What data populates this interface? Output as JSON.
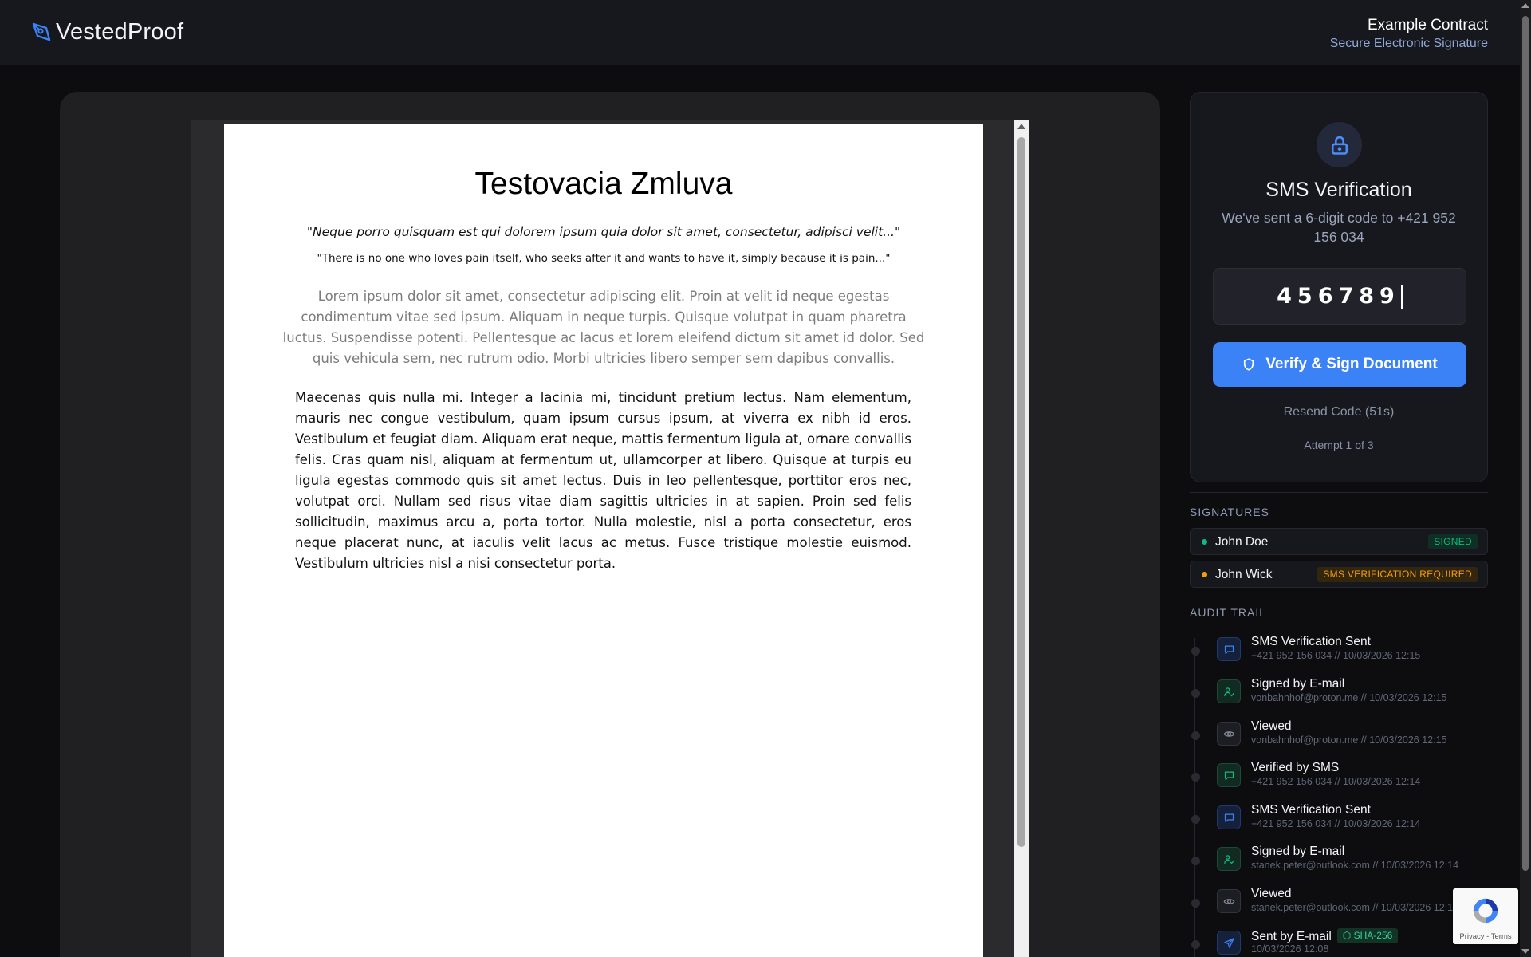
{
  "header": {
    "brand": "VestedProof",
    "doc_title": "Example Contract",
    "doc_subtitle": "Secure Electronic Signature"
  },
  "document": {
    "title": "Testovacia Zmluva",
    "quote_italic": "\"Neque porro quisquam est qui dolorem ipsum quia dolor sit amet, consectetur, adipisci velit...\"",
    "quote_plain": "\"There is no one who loves pain itself, who seeks after it and wants to have it, simply because it is pain...\"",
    "paragraph_gray": "Lorem ipsum dolor sit amet, consectetur adipiscing elit. Proin at velit id neque egestas condimentum vitae sed ipsum. Aliquam in neque turpis. Quisque volutpat in quam pharetra luctus. Suspendisse potenti. Pellentesque ac lacus et lorem eleifend dictum sit amet id dolor. Sed quis vehicula sem, nec rutrum odio. Morbi ultricies libero semper sem dapibus convallis.",
    "paragraph_body": "Maecenas quis nulla mi. Integer a lacinia mi, tincidunt pretium lectus. Nam elementum, mauris nec congue vestibulum, quam ipsum cursus ipsum, at viverra ex nibh id eros. Vestibulum et feugiat diam. Aliquam erat neque, mattis fermentum ligula at, ornare convallis felis. Cras quam nisl, aliquam at fermentum ut, ullamcorper at libero. Quisque at turpis eu ligula egestas commodo quis sit amet lectus. Duis in leo pellentesque, porttitor eros nec, volutpat orci. Nullam sed risus vitae diam sagittis ultricies in at sapien. Proin sed felis sollicitudin, maximus arcu a, porta tortor. Nulla molestie, nisl a porta consectetur, eros neque placerat nunc, at iaculis velit lacus ac metus. Fusce tristique molestie euismod. Vestibulum ultricies nisl a nisi consectetur porta."
  },
  "sms": {
    "icon": "lock-icon",
    "title": "SMS Verification",
    "description": "We've sent a 6-digit code to +421 952 156 034",
    "code_value": "456789",
    "verify_button": "Verify & Sign Document",
    "resend": "Resend Code (51s)",
    "attempt": "Attempt 1 of 3"
  },
  "signatures": {
    "title": "SIGNATURES",
    "items": [
      {
        "name": "John Doe",
        "status": "SIGNED",
        "color": "#10b981",
        "badge_bg": "#0f2e24"
      },
      {
        "name": "John Wick",
        "status": "SMS VERIFICATION REQUIRED",
        "color": "#f59e0b",
        "badge_bg": "#33260f"
      }
    ]
  },
  "audit": {
    "title": "AUDIT TRAIL",
    "items": [
      {
        "title": "SMS Verification Sent",
        "sub": "+421 952 156 034 // 10/03/2026 12:15",
        "icon": "message-icon",
        "tone": "blue"
      },
      {
        "title": "Signed by E-mail",
        "sub": "vonbahnhof@proton.me // 10/03/2026 12:15",
        "icon": "user-check-icon",
        "tone": "green"
      },
      {
        "title": "Viewed",
        "sub": "vonbahnhof@proton.me // 10/03/2026 12:15",
        "icon": "eye-icon",
        "tone": "gray"
      },
      {
        "title": "Verified by SMS",
        "sub": "+421 952 156 034 // 10/03/2026 12:14",
        "icon": "message-icon",
        "tone": "green"
      },
      {
        "title": "SMS Verification Sent",
        "sub": "+421 952 156 034 // 10/03/2026 12:14",
        "icon": "message-icon",
        "tone": "blue"
      },
      {
        "title": "Signed by E-mail",
        "sub": "stanek.peter@outlook.com // 10/03/2026 12:14",
        "icon": "user-check-icon",
        "tone": "green"
      },
      {
        "title": "Viewed",
        "sub": "stanek.peter@outlook.com // 10/03/2026 12:14",
        "icon": "eye-icon",
        "tone": "gray"
      },
      {
        "title": "Sent by E-mail",
        "sub": "10/03/2026 12:08",
        "icon": "send-icon",
        "tone": "blue",
        "badge": "SHA-256"
      }
    ]
  },
  "recaptcha": {
    "text": "Privacy - Terms"
  }
}
